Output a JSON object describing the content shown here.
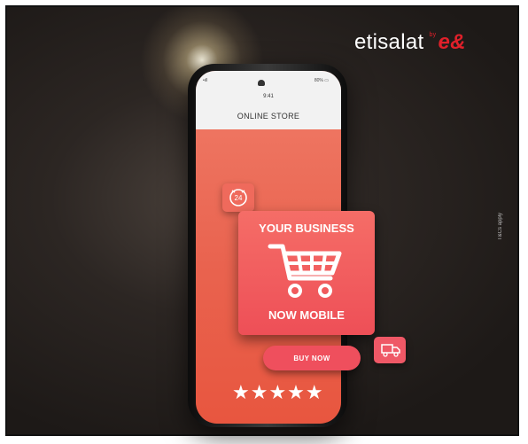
{
  "brand": {
    "name": "etisalat",
    "by": "by",
    "mark": "e&"
  },
  "side_note": "T&Cs apply",
  "phone": {
    "status_left": "•ıll ",
    "status_right": "80% ▭",
    "time": "9:41",
    "store_title": "ONLINE STORE"
  },
  "promo": {
    "headline": "YOUR BUSINESS",
    "subline": "NOW MOBILE"
  },
  "badges": {
    "hours": "24"
  },
  "buy_button_label": "BUY NOW",
  "rating": {
    "stars": "★★★★★",
    "value": 5,
    "max": 5
  },
  "colors": {
    "accent": "#ee4f57",
    "brand_red": "#e0202a",
    "background": "#2c2623"
  },
  "icons": [
    "cart-icon",
    "clock-24-icon",
    "truck-icon",
    "star-icon"
  ]
}
